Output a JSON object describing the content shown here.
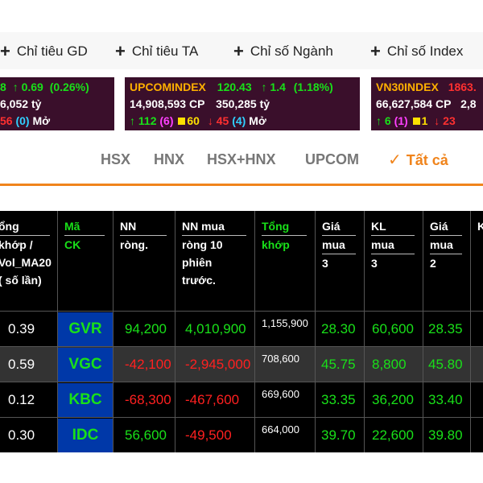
{
  "tabs": [
    {
      "label": "Chỉ tiêu GD"
    },
    {
      "label": "Chỉ tiêu TA"
    },
    {
      "label": "Chỉ số Ngành"
    },
    {
      "label": "Chỉ số Index"
    }
  ],
  "tickers": [
    {
      "index": "",
      "value": "8",
      "change": "0.69",
      "pct": "(0.26%)",
      "volume": "",
      "cp": "",
      "amount": "6,052",
      "ty": "tỷ",
      "down": "56",
      "nochange": "(0)",
      "status": "Mở"
    },
    {
      "index": "UPCOMINDEX",
      "value": "120.43",
      "change": "1.4",
      "pct": "(1.18%)",
      "volume": "14,908,593",
      "cp": "CP",
      "amount": "350,285",
      "ty": "tỷ",
      "up": "112",
      "ceil": "(6)",
      "ref": "60",
      "down": "45",
      "floor": "(4)",
      "status": "Mở"
    },
    {
      "index": "VN30INDEX",
      "value": "1863.",
      "volume": "66,627,584",
      "cp": "CP",
      "amount": "2,8",
      "up": "6",
      "ceil": "(1)",
      "ref": "1",
      "down": "23"
    }
  ],
  "exchanges": [
    "HSX",
    "HNX",
    "HSX+HNX",
    "UPCOM",
    "Tất cả"
  ],
  "active_exchange_check": "✓",
  "headers": {
    "vol_ratio": [
      "ổng",
      "khớp /",
      "Vol_MA20",
      "( số lần)"
    ],
    "symbol": [
      "Mã",
      "CK"
    ],
    "nn_net": [
      "NN",
      "ròng."
    ],
    "nn_net10": [
      "NN mua",
      "ròng 10",
      "phiên",
      "trước."
    ],
    "total": [
      "Tổng",
      "khớp"
    ],
    "bid3": [
      "Giá",
      "mua",
      "3"
    ],
    "kl3": [
      "KL",
      "mua",
      "3"
    ],
    "bid2": [
      "Giá",
      "mua",
      "2"
    ],
    "partial": [
      "K"
    ]
  },
  "rows": [
    {
      "ratio": "0.39",
      "sym": "GVR",
      "nn": "94,200",
      "nn10": "4,010,900",
      "total": "1,155,900",
      "bid3": "28.30",
      "kl3": "60,600",
      "bid2": "28.35",
      "nn_color": "#19e019",
      "nn10_color": "#19e019"
    },
    {
      "ratio": "0.59",
      "sym": "VGC",
      "nn": "-42,100",
      "nn10": "-2,945,000",
      "total": "708,600",
      "bid3": "45.75",
      "kl3": "8,800",
      "bid2": "45.80",
      "nn_color": "#ff2020",
      "nn10_color": "#ff2020"
    },
    {
      "ratio": "0.12",
      "sym": "KBC",
      "nn": "-68,300",
      "nn10": "-467,600",
      "total": "669,600",
      "bid3": "33.35",
      "kl3": "36,200",
      "bid2": "33.40",
      "nn_color": "#ff2020",
      "nn10_color": "#ff2020"
    },
    {
      "ratio": "0.30",
      "sym": "IDC",
      "nn": "56,600",
      "nn10": "-49,500",
      "total": "664,000",
      "bid3": "39.70",
      "kl3": "22,600",
      "bid2": "39.80",
      "nn_color": "#19e019",
      "nn10_color": "#ff2020"
    }
  ],
  "colors": {
    "accent": "#f0841c",
    "ticker_bg": "#3a0f2b",
    "symbol_bg": "#0038a8",
    "up": "#19e019",
    "down": "#ff2020"
  }
}
